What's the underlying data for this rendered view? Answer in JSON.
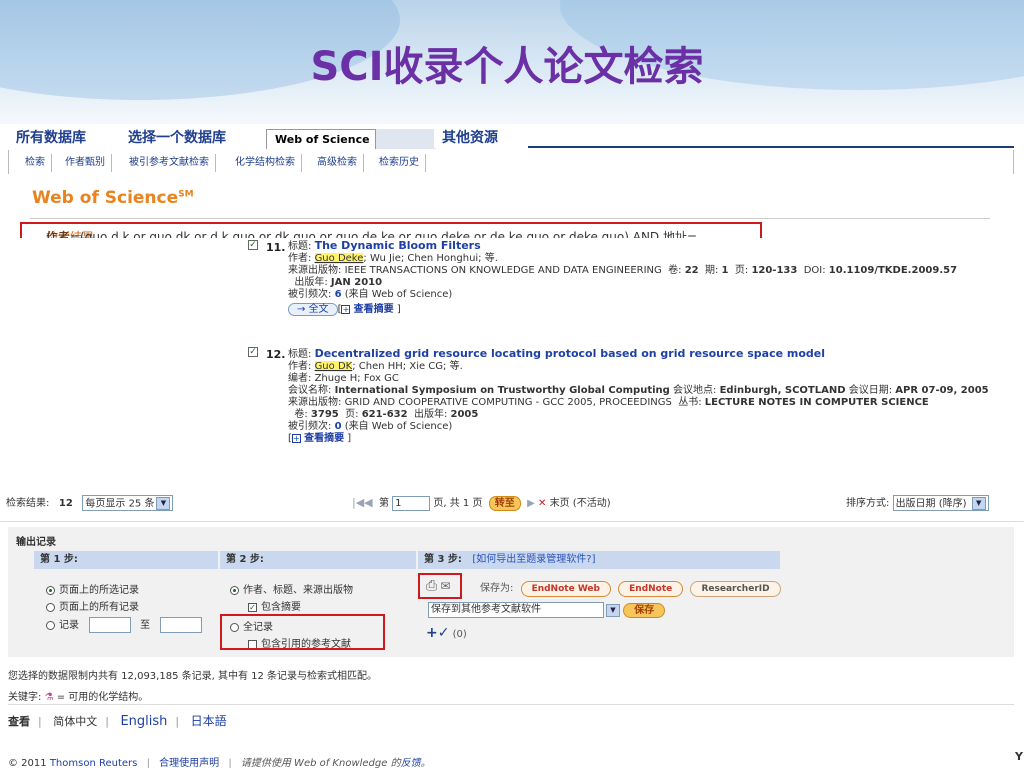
{
  "slide": {
    "title": "SCI收录个人论文检索"
  },
  "db_tabs": [
    {
      "label": "所有数据库"
    },
    {
      "label": "选择一个数据库"
    },
    {
      "label": "Web of Science"
    },
    {
      "label": "其他资源"
    }
  ],
  "sub_tabs": [
    "检索",
    "作者甄别",
    "被引参考文献检索",
    "化学结构检索",
    "高级检索",
    "检索历史"
  ],
  "brand": {
    "name": "Web of Science",
    "mark": "SM"
  },
  "search_summary": {
    "label": "检索结果",
    "query": "作者=(guo d k or guo dk or d k guo or dk guo or guo de ke or guo deke or de ke guo or deke guo) AND 地址="
  },
  "records": [
    {
      "num": "11.",
      "title_label": "标题:",
      "title": "The Dynamic Bloom Filters",
      "authors_label": "作者:",
      "author_hl": "Guo Deke",
      "authors_rest": "; Wu Jie; Chen Honghui; 等.",
      "source_label": "来源出版物:",
      "source": "IEEE TRANSACTIONS ON KNOWLEDGE AND DATA ENGINEERING",
      "vol_label": "卷:",
      "vol": "22",
      "issue_label": "期:",
      "issue": "1",
      "pages_label": "页:",
      "pages": "120-133",
      "doi_label": "DOI:",
      "doi": "10.1109/TKDE.2009.57",
      "year_label": "出版年:",
      "year": "JAN 2010",
      "cited_label": "被引频次:",
      "cited": "6",
      "cited_from": "(来自 Web of Science)",
      "fulltext": "→ 全文",
      "abstract": "查看摘要"
    },
    {
      "num": "12.",
      "title_label": "标题:",
      "title": "Decentralized grid resource locating protocol based on grid resource space model",
      "authors_label": "作者:",
      "author_hl": "Guo DK",
      "authors_rest": "; Chen HH; Xie CG; 等.",
      "editors_label": "编者:",
      "editors": "Zhuge H; Fox GC",
      "conf_label": "会议名称:",
      "conf": "International Symposium on Trustworthy Global Computing",
      "loc_label": "会议地点:",
      "loc": "Edinburgh, SCOTLAND",
      "date_label": "会议日期:",
      "date": "APR 07-09, 2005",
      "source_label": "来源出版物:",
      "source": "GRID AND COOPERATIVE COMPUTING - GCC 2005, PROCEEDINGS",
      "series_label": "丛书:",
      "series": "LECTURE NOTES IN COMPUTER SCIENCE",
      "vol_label": "卷:",
      "vol": "3795",
      "pages_label": "页:",
      "pages": "621-632",
      "year_label": "出版年:",
      "year": "2005",
      "cited_label": "被引频次:",
      "cited": "0",
      "cited_from": "(来自 Web of Science)",
      "abstract": "查看摘要"
    }
  ],
  "results_bar": {
    "count_label": "检索结果:",
    "count": "12",
    "per_page": "每页显示 25 条",
    "page_prefix": "第",
    "page_value": "1",
    "page_suffix": "页, 共 1 页",
    "go": "转至",
    "last_page": "末页 (不活动)",
    "sort_label": "排序方式:",
    "sort_value": "出版日期 (降序)"
  },
  "output": {
    "title": "输出记录",
    "step1": "第 1 步:",
    "step2": "第 2 步:",
    "step3": "第 3 步:",
    "step3_link": "[如何导出至题录管理软件?]",
    "s1_opt1": "页面上的所选记录",
    "s1_opt2": "页面上的所有记录",
    "s1_opt3": "记录",
    "s1_to": "至",
    "s2_opt1": "作者、标题、来源出版物",
    "s2_chk1": "包含摘要",
    "s2_opt2": "全记录",
    "s2_chk2": "包含引用的参考文献",
    "save_as": "保存为:",
    "endnote_web": "EndNote Web",
    "endnote": "EndNote",
    "researcherid": "ResearcherID",
    "save_select": "保存到其他参考文献软件",
    "save_btn": "保存",
    "marked_count": "(0)"
  },
  "footer": {
    "db_limit": "您选择的数据限制内共有 12,093,185 条记录, 其中有 12 条记录与检索式相匹配。",
    "key": "关键字:",
    "key_desc": "= 可用的化学结构。",
    "view": "查看",
    "simplified": "简体中文",
    "english": "English",
    "japanese": "日本語",
    "copyright": "© 2011",
    "thomson": "Thomson Reuters",
    "terms": "合理使用声明",
    "feedback_pre": "请提供使用 Web of Knowledge 的",
    "feedback_link": "反馈",
    "feedback_post": "。",
    "corner": "Y"
  }
}
